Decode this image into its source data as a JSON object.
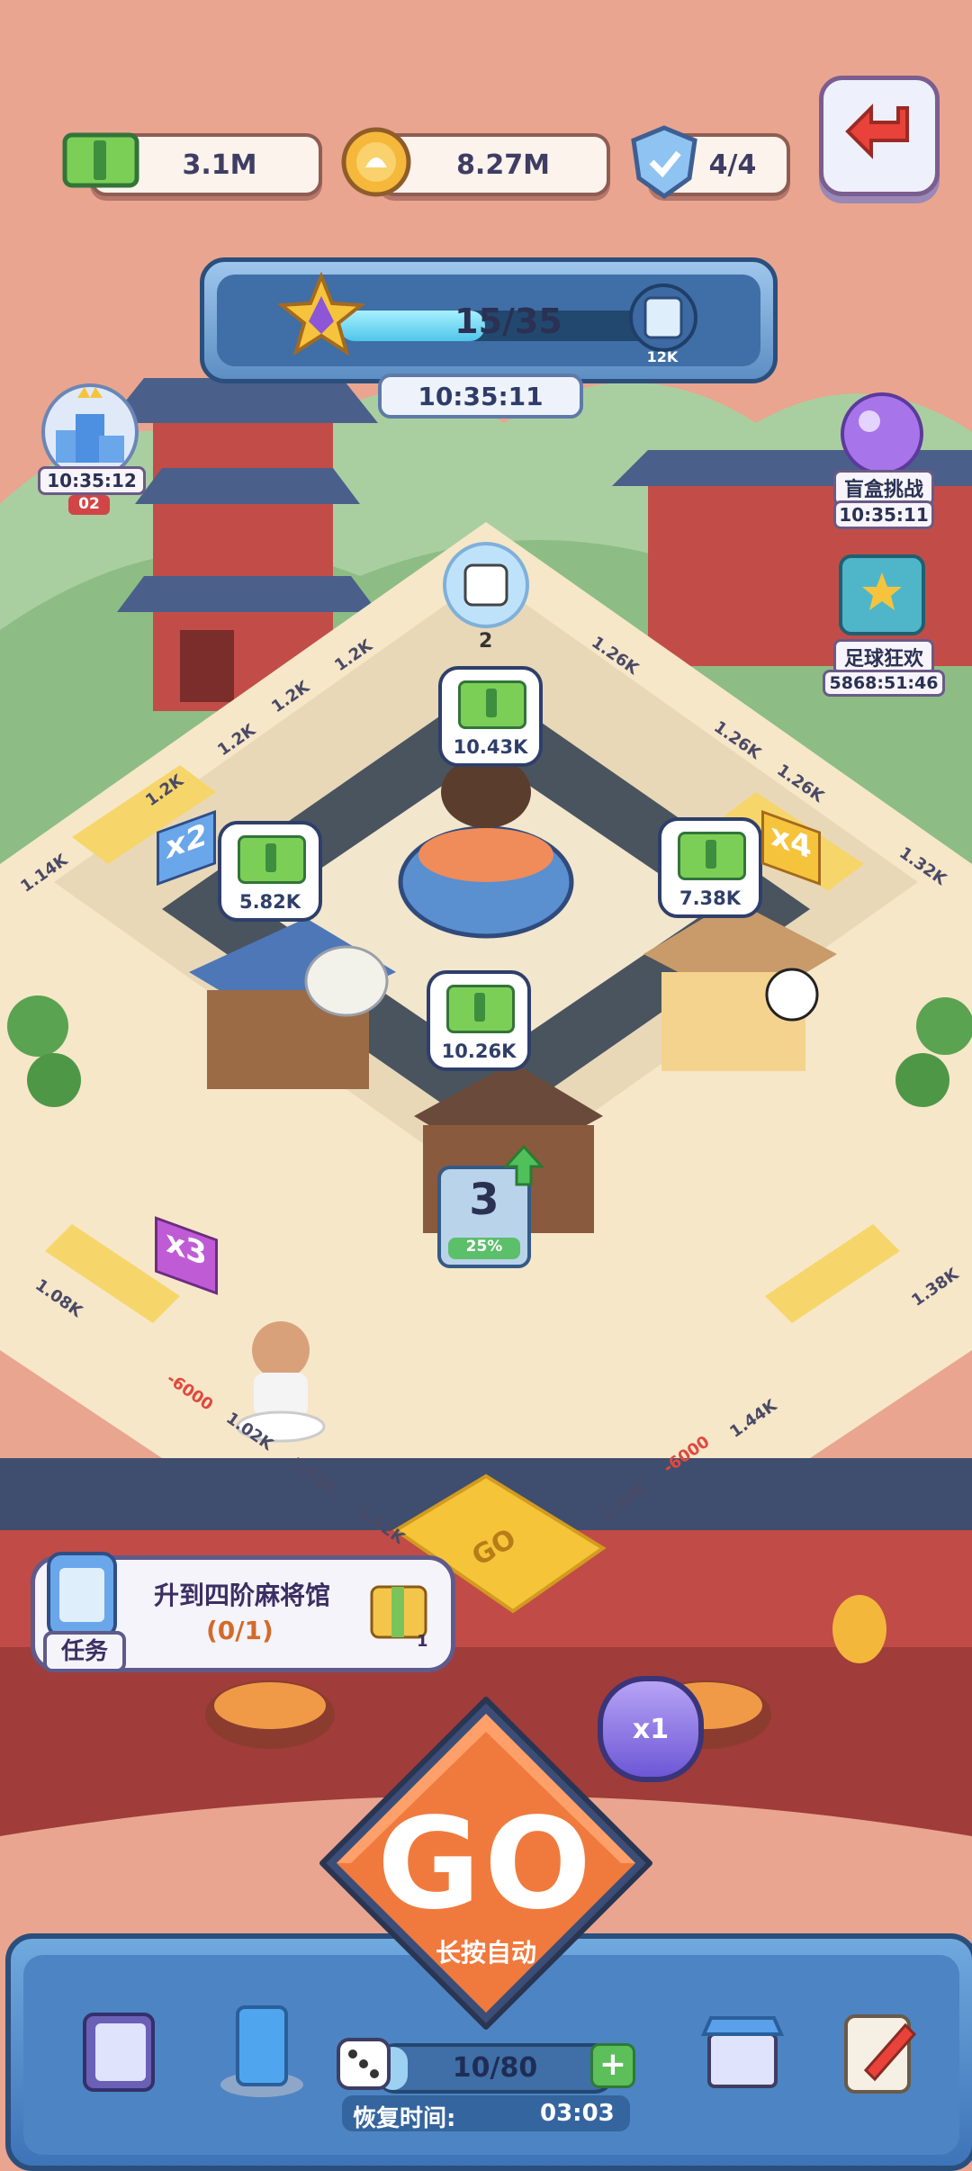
{
  "top_bar": {
    "cash": "3.1M",
    "coins": "8.27M",
    "shields": "4/4"
  },
  "level_banner": {
    "progress_text": "15/35",
    "progress_fraction": 0.43,
    "reward_amount": "12K",
    "timer": "10:35:11"
  },
  "left_event": {
    "timer": "10:35:12",
    "rank": "02"
  },
  "right_events": [
    {
      "label": "盲盒挑战",
      "timer": "10:35:11"
    },
    {
      "label": "足球狂欢",
      "timer": "5868:51:46"
    }
  ],
  "board": {
    "dice_tile_value": "2",
    "buildings": [
      {
        "name": "hotpot",
        "cash": "10.43K"
      },
      {
        "name": "teahouse",
        "cash": "5.82K"
      },
      {
        "name": "pavilion",
        "cash": "7.38K"
      },
      {
        "name": "center",
        "cash": "10.26K"
      }
    ],
    "center_level": "3",
    "center_level_progress": "25%",
    "multipliers": [
      "x2",
      "x4",
      "x3"
    ],
    "tile_values": [
      "1.2K",
      "1.2K",
      "1.2K",
      "1.2K",
      "1.14K",
      "1.26K",
      "1.26K",
      "1.26K",
      "1.32K",
      "1.08K",
      "1.02K",
      "1.02K",
      "1.02K",
      "1.44K",
      "1.44K",
      "1.38K"
    ],
    "penalties": [
      "-6000",
      "-6000"
    ]
  },
  "quest": {
    "tag": "任务",
    "title": "升到四阶麻将馆",
    "progress": "(0/1)",
    "reward_count": "1"
  },
  "go_button": {
    "label": "GO",
    "sublabel": "长按自动",
    "multiplier": "x1",
    "board_go": "GO"
  },
  "bottom_bar": {
    "dice_count": "10/80",
    "recovery_label": "恢复时间:",
    "recovery_time": "03:03"
  },
  "colors": {
    "background": "#e9a58f",
    "go_orange": "#f07a3d",
    "panel_blue": "#4d84c4",
    "cash_green": "#7ccf56",
    "coin_gold": "#f5b83a"
  }
}
